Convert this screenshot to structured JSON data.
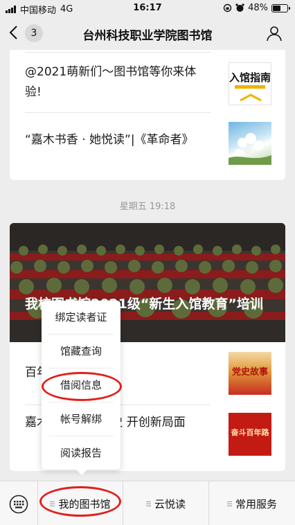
{
  "status_bar": {
    "carrier": "中国移动",
    "network": "4G",
    "time": "16:17",
    "battery": "48%",
    "battery_level": 0.48
  },
  "nav": {
    "back_icon": "chevron-left-icon",
    "unread_count": "3",
    "title": "台州科技职业学院图书馆",
    "user_icon": "user-icon"
  },
  "feed": {
    "card1": {
      "items": [
        {
          "title": "@2021萌新们～图书馆等你来体验!",
          "thumb_text": "入馆指南"
        },
        {
          "title": "“嘉木书香 · 她悦读”|《革命者》"
        }
      ]
    },
    "divider_time": "星期五 19:18",
    "card2": {
      "headline": "我校图书馆2021级“新生入馆教育”培训",
      "items": [
        {
          "title": "百年党史",
          "thumb_text": "党史故事"
        },
        {
          "title": "嘉木书香·百年党史 开创新局面",
          "thumb_text": "奋斗百年路"
        }
      ]
    }
  },
  "popup_menu": {
    "items": [
      "绑定读者证",
      "馆藏查询",
      "借阅信息",
      "帐号解绑",
      "阅读报告"
    ],
    "highlighted": "借阅信息"
  },
  "bottom_menu": {
    "keyboard_icon": "keyboard-icon",
    "items": [
      "我的图书馆",
      "云悦读",
      "常用服务"
    ],
    "active": "我的图书馆"
  },
  "colors": {
    "highlight_ring": "#e0201c",
    "background": "#ededed"
  }
}
